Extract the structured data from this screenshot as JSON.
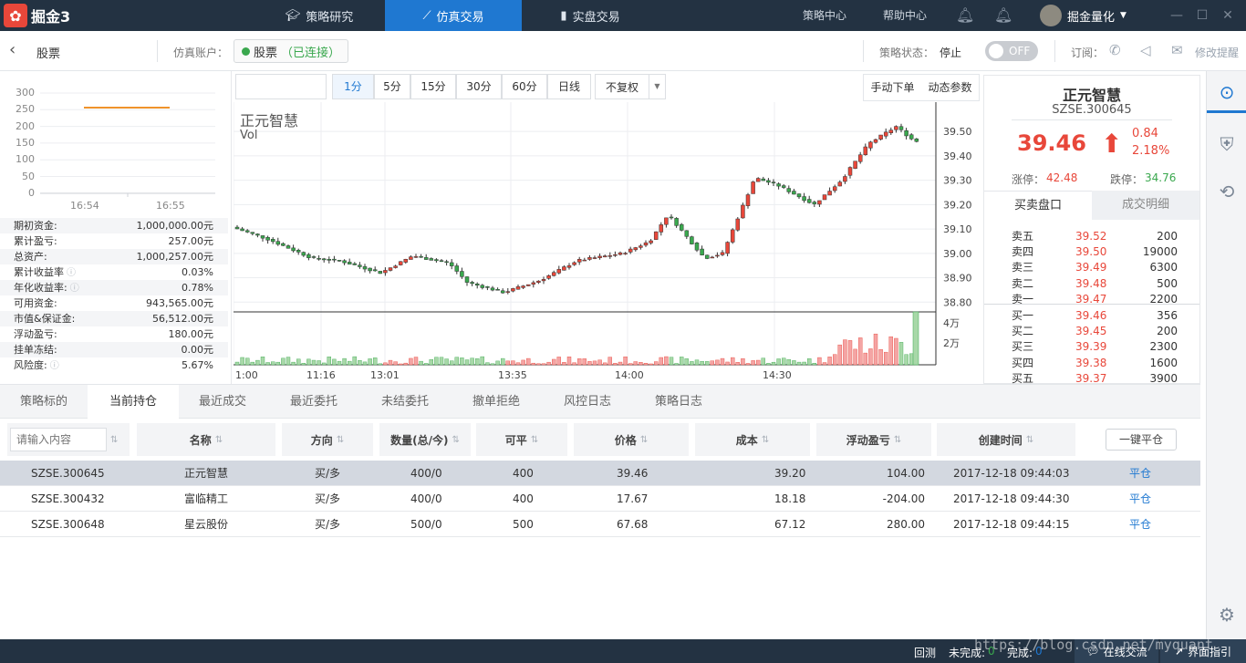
{
  "app": {
    "logo_text": "掘金3"
  },
  "nav": {
    "tabs": [
      {
        "label": "策略研究"
      },
      {
        "label": "仿真交易"
      },
      {
        "label": "实盘交易"
      }
    ],
    "strategy_center": "策略中心",
    "help_center": "帮助中心",
    "user_name": "掘金量化"
  },
  "subbar": {
    "title": "股票",
    "account_label": "仿真账户：",
    "account_name": "股票",
    "account_status": "（已连接）",
    "strategy_status_label": "策略状态：",
    "strategy_status": "停止",
    "toggle": "OFF",
    "subscribe_label": "订阅：",
    "edit_reminder": "修改提醒"
  },
  "left": {
    "y_ticks": [
      "300",
      "250",
      "200",
      "150",
      "100",
      "50",
      "0"
    ],
    "x_ticks": [
      "16:54",
      "16:55"
    ],
    "stats": [
      {
        "label": "期初资金:",
        "value": "1,000,000.00元"
      },
      {
        "label": "累计盈亏:",
        "value": "257.00元"
      },
      {
        "label": "总资产:",
        "value": "1,000,257.00元"
      },
      {
        "label": "累计收益率",
        "value": "0.03%"
      },
      {
        "label": "年化收益率:",
        "value": "0.78%"
      },
      {
        "label": "可用资金:",
        "value": "943,565.00元"
      },
      {
        "label": "市值&保证金:",
        "value": "56,512.00元"
      },
      {
        "label": "浮动盈亏:",
        "value": "180.00元"
      },
      {
        "label": "挂单冻结:",
        "value": "0.00元"
      },
      {
        "label": "风险度:",
        "value": "5.67%"
      }
    ]
  },
  "chart_toolbar": {
    "periods": [
      "1分",
      "5分",
      "15分",
      "30分",
      "60分",
      "日线"
    ],
    "adjust": "不复权",
    "manual_order": "手动下单",
    "dynamic_params": "动态参数"
  },
  "chart_data": {
    "type": "candlestick",
    "title": "正元智慧",
    "sub_label": "Vol",
    "y_ticks": [
      "39.50",
      "39.40",
      "39.30",
      "39.20",
      "39.10",
      "39.00",
      "38.90",
      "38.80"
    ],
    "vol_ticks": [
      "4万",
      "2万"
    ],
    "x_ticks": [
      "1:00",
      "11:16",
      "13:01",
      "13:35",
      "14:00",
      "14:30"
    ],
    "ylim": [
      38.76,
      39.62
    ]
  },
  "quote": {
    "name": "正元智慧",
    "code": "SZSE.300645",
    "price": "39.46",
    "change": "0.84",
    "change_pct": "2.18%",
    "limit_up_label": "涨停：",
    "limit_up": "42.48",
    "limit_down_label": "跌停：",
    "limit_down": "34.76",
    "tab_book": "买卖盘口",
    "tab_trades": "成交明细",
    "asks": [
      {
        "l": "卖五",
        "p": "39.52",
        "v": "200"
      },
      {
        "l": "卖四",
        "p": "39.50",
        "v": "19000"
      },
      {
        "l": "卖三",
        "p": "39.49",
        "v": "6300"
      },
      {
        "l": "卖二",
        "p": "39.48",
        "v": "500"
      },
      {
        "l": "卖一",
        "p": "39.47",
        "v": "2200"
      }
    ],
    "bids": [
      {
        "l": "买一",
        "p": "39.46",
        "v": "356"
      },
      {
        "l": "买二",
        "p": "39.45",
        "v": "200"
      },
      {
        "l": "买三",
        "p": "39.39",
        "v": "2300"
      },
      {
        "l": "买四",
        "p": "39.38",
        "v": "1600"
      },
      {
        "l": "买五",
        "p": "39.37",
        "v": "3900"
      }
    ]
  },
  "bottom_tabs": [
    "策略标的",
    "当前持仓",
    "最近成交",
    "最近委托",
    "未结委托",
    "撤单拒绝",
    "风控日志",
    "策略日志"
  ],
  "table": {
    "search_placeholder": "请输入内容",
    "headers": [
      "名称",
      "方向",
      "数量(总/今)",
      "可平",
      "价格",
      "成本",
      "浮动盈亏",
      "创建时间"
    ],
    "close_all": "一键平仓",
    "rows": [
      {
        "code": "SZSE.300645",
        "name": "正元智慧",
        "dir": "买/多",
        "qty": "400/0",
        "avail": "400",
        "price": "39.46",
        "cost": "39.20",
        "pnl": "104.00",
        "time": "2017-12-18 09:44:03",
        "action": "平仓"
      },
      {
        "code": "SZSE.300432",
        "name": "富临精工",
        "dir": "买/多",
        "qty": "400/0",
        "avail": "400",
        "price": "17.67",
        "cost": "18.18",
        "pnl": "-204.00",
        "time": "2017-12-18 09:44:30",
        "action": "平仓"
      },
      {
        "code": "SZSE.300648",
        "name": "星云股份",
        "dir": "买/多",
        "qty": "500/0",
        "avail": "500",
        "price": "67.68",
        "cost": "67.12",
        "pnl": "280.00",
        "time": "2017-12-18 09:44:15",
        "action": "平仓"
      }
    ]
  },
  "status": {
    "backtest": "回测",
    "unfinished_label": "未完成:",
    "unfinished": "0",
    "finished_label": "完成:",
    "finished": "0",
    "online": "在线交流",
    "guide": "界面指引",
    "watermark": "https://blog.csdn.net/myquant"
  },
  "colors": {
    "up": "#e8473a",
    "down": "#3aa84e",
    "accent": "#1f78d1",
    "dark": "#233242"
  }
}
